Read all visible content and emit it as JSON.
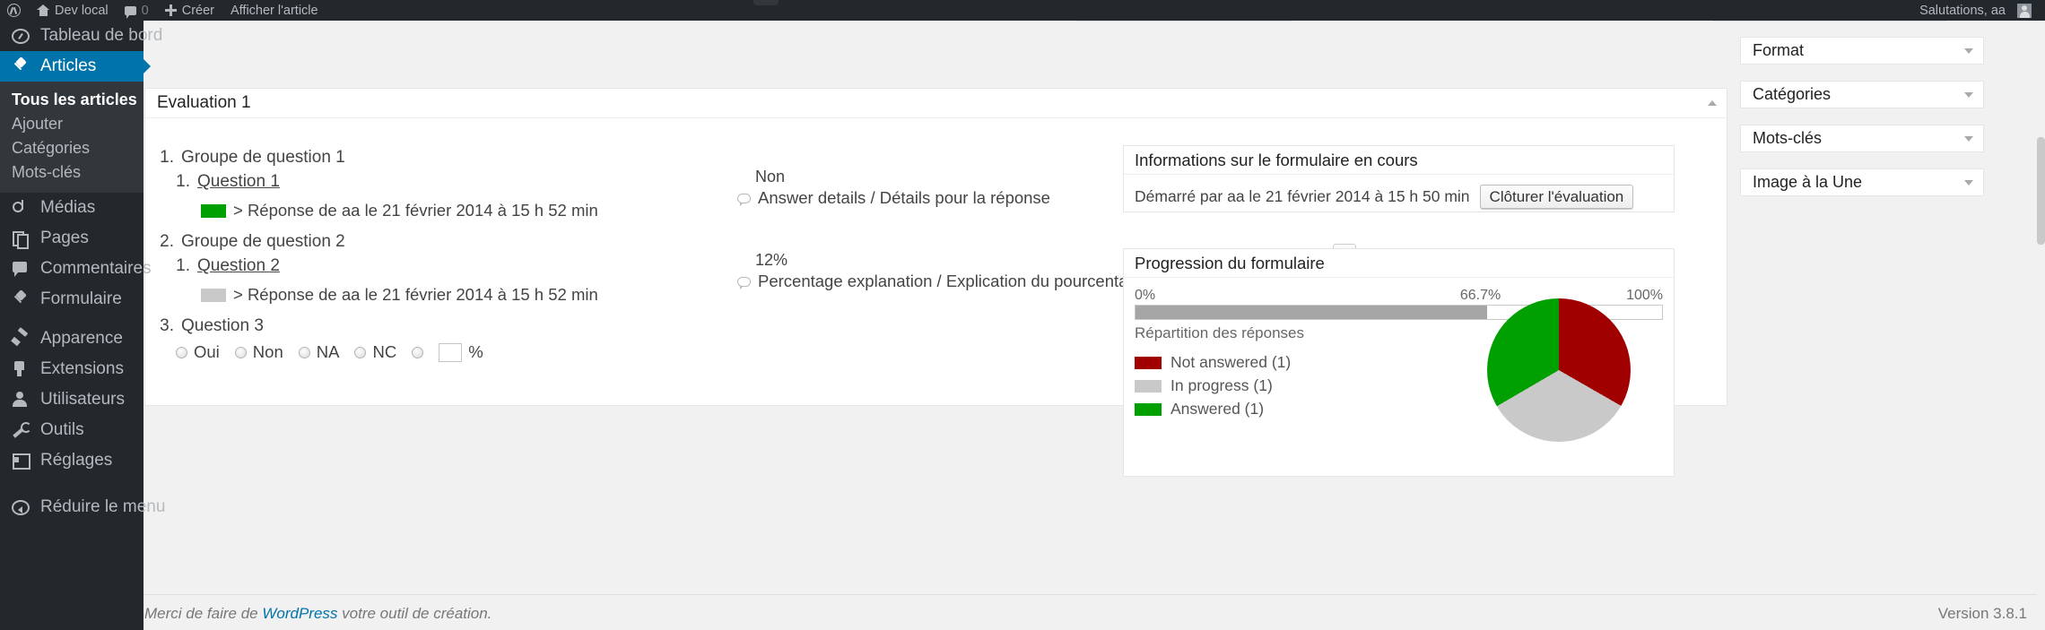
{
  "adminbar": {
    "logo_icon": "wordpress-logo-icon",
    "site_name": "Dev local",
    "home_icon": "home-icon",
    "comments_icon": "comment-bubble-icon",
    "comments_count": "0",
    "new_icon": "plus-icon",
    "new_label": "Créer",
    "view_post_label": "Afficher l'article",
    "greeting": "Salutations, aa",
    "avatar_icon": "user-avatar-icon"
  },
  "sidebar": {
    "items": [
      {
        "label": "Tableau de bord",
        "icon": "dashboard-icon",
        "current": false
      },
      {
        "label": "Articles",
        "icon": "pin-icon",
        "current": true
      },
      {
        "label": "Médias",
        "icon": "media-icon",
        "current": false
      },
      {
        "label": "Pages",
        "icon": "pages-icon",
        "current": false
      },
      {
        "label": "Commentaires",
        "icon": "comment-icon",
        "current": false
      },
      {
        "label": "Formulaire",
        "icon": "pin-icon",
        "current": false
      },
      {
        "label": "Apparence",
        "icon": "brush-icon",
        "current": false
      },
      {
        "label": "Extensions",
        "icon": "plugin-icon",
        "current": false
      },
      {
        "label": "Utilisateurs",
        "icon": "users-icon",
        "current": false
      },
      {
        "label": "Outils",
        "icon": "tools-icon",
        "current": false
      },
      {
        "label": "Réglages",
        "icon": "settings-icon",
        "current": false
      }
    ],
    "submenu": [
      {
        "label": "Tous les articles",
        "current": true
      },
      {
        "label": "Ajouter",
        "current": false
      },
      {
        "label": "Catégories",
        "current": false
      },
      {
        "label": "Mots-clés",
        "current": false
      }
    ],
    "collapse_label": "Réduire le menu",
    "collapse_icon": "collapse-arrow-icon",
    "accent_color": "#0073aa",
    "background_color": "#23282d"
  },
  "main": {
    "postbox_title": "Evaluation 1",
    "toggle_icon": "chevron-up-icon",
    "groups": [
      {
        "number": "1.",
        "label": "Groupe de question 1",
        "question_number": "1.",
        "question_label": "Question 1",
        "swatch_color": "#00a000",
        "answer_text": "> Réponse de aa le 21 février 2014 à 15 h 52 min"
      },
      {
        "number": "2.",
        "label": "Groupe de question 2",
        "question_number": "1.",
        "question_label": "Question 2",
        "swatch_color": "#c9c9c9",
        "answer_text": "> Réponse de aa le 21 février 2014 à 15 h 52 min"
      }
    ],
    "question3": {
      "number": "3.",
      "label": "Question 3",
      "options": [
        "Oui",
        "Non",
        "NA",
        "NC"
      ],
      "percent_value": "",
      "percent_suffix": "%"
    },
    "answers": [
      {
        "value": "Non",
        "detail_icon": "speech-bubble-icon",
        "detail": "Answer details / Détails pour la réponse",
        "edit_icon": "pencil-icon"
      },
      {
        "value": "12%",
        "detail_icon": "speech-bubble-icon",
        "detail": "Percentage explanation / Explication du pourcentage",
        "edit_icon": "pencil-icon"
      }
    ]
  },
  "info_box": {
    "title": "Informations sur le formulaire en cours",
    "started_text": "Démarré par aa le 21 février 2014 à 15 h 50 min",
    "close_button": "Clôturer l'évaluation"
  },
  "progress_box": {
    "title": "Progression du formulaire",
    "scale_min": "0%",
    "scale_mid": "66.7%",
    "scale_max": "100%",
    "fill_percent": 66.7,
    "fill_color": "#a5a5a5",
    "caption": "Répartition des réponses"
  },
  "chart_data": {
    "type": "pie",
    "title": "Répartition des réponses",
    "categories": [
      "Not answered (1)",
      "In progress (1)",
      "Answered (1)"
    ],
    "values": [
      1,
      1,
      1
    ],
    "percentages": [
      33.3,
      33.3,
      33.3
    ],
    "colors": [
      "#a00000",
      "#c9c9c9",
      "#00a000"
    ],
    "legend_position": "left",
    "legend": [
      {
        "label": "Not answered (1)",
        "color": "#a00000"
      },
      {
        "label": "In progress (1)",
        "color": "#c9c9c9"
      },
      {
        "label": "Answered (1)",
        "color": "#00a000"
      }
    ],
    "start_angle_deg": 0,
    "grid": false
  },
  "side_boxes": [
    {
      "title": "Format",
      "toggle_icon": "chevron-down-icon"
    },
    {
      "title": "Catégories",
      "toggle_icon": "chevron-down-icon"
    },
    {
      "title": "Mots-clés",
      "toggle_icon": "chevron-down-icon"
    },
    {
      "title": "Image à la Une",
      "toggle_icon": "chevron-down-icon"
    }
  ],
  "footer": {
    "thanks_prefix": "Merci de faire de ",
    "thanks_link": "WordPress",
    "thanks_suffix": " votre outil de création.",
    "version": "Version 3.8.1"
  }
}
